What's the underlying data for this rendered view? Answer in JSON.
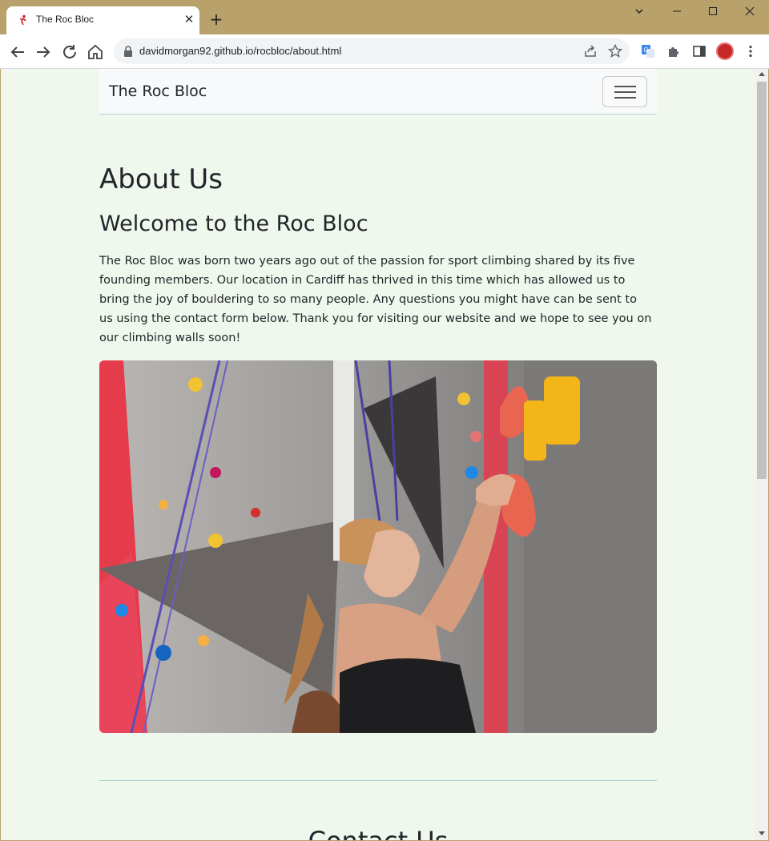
{
  "browser": {
    "tab_title": "The Roc Bloc",
    "url": "davidmorgan92.github.io/rocbloc/about.html"
  },
  "site": {
    "brand": "The Roc Bloc"
  },
  "about": {
    "title": "About Us",
    "subtitle": "Welcome to the Roc Bloc",
    "body": "The Roc Bloc was born two years ago out of the passion for sport climbing shared by its five founding members. Our location in Cardiff has thrived in this time which has allowed us to bring the joy of bouldering to so many people. Any questions you might have can be sent to us using the contact form below. Thank you for visiting our website and we hope to see you on our climbing walls soon!"
  },
  "contact": {
    "heading": "Contact Us"
  },
  "colors": {
    "page_background": "#f0f8ee",
    "accent_line": "#a8d5cf",
    "frame": "#b8a16a"
  }
}
